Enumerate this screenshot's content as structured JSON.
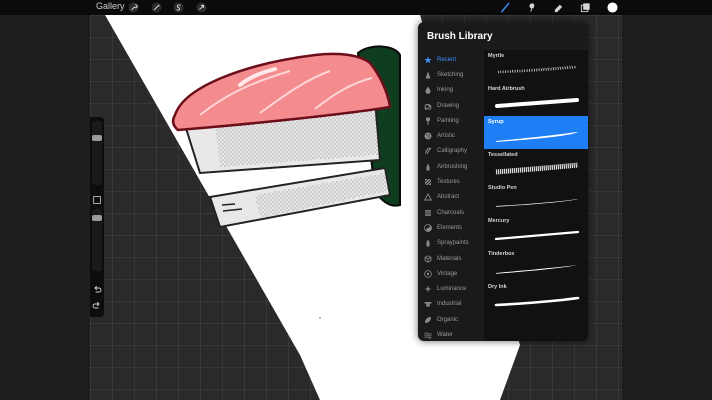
{
  "app": {
    "gallery_label": "Gallery"
  },
  "brush_library": {
    "title": "Brush Library",
    "selected_category": "Recent",
    "selected_brush": "Syrup",
    "categories": [
      {
        "label": "Recent",
        "icon": "star-icon"
      },
      {
        "label": "Sketching",
        "icon": "pencil-tip-icon"
      },
      {
        "label": "Inking",
        "icon": "ink-drop-icon"
      },
      {
        "label": "Drawing",
        "icon": "spiral-icon"
      },
      {
        "label": "Painting",
        "icon": "paint-brush-icon"
      },
      {
        "label": "Artistic",
        "icon": "palette-icon"
      },
      {
        "label": "Calligraphy",
        "icon": "calligraphy-icon"
      },
      {
        "label": "Airbrushing",
        "icon": "airbrush-icon"
      },
      {
        "label": "Textures",
        "icon": "texture-icon"
      },
      {
        "label": "Abstract",
        "icon": "triangle-icon"
      },
      {
        "label": "Charcoals",
        "icon": "charcoal-icon"
      },
      {
        "label": "Elements",
        "icon": "yin-yang-icon"
      },
      {
        "label": "Spraypaints",
        "icon": "spray-can-icon"
      },
      {
        "label": "Materials",
        "icon": "cube-icon"
      },
      {
        "label": "Vintage",
        "icon": "vintage-star-icon"
      },
      {
        "label": "Luminance",
        "icon": "sparkle-icon"
      },
      {
        "label": "Industrial",
        "icon": "anvil-icon"
      },
      {
        "label": "Organic",
        "icon": "leaf-icon"
      },
      {
        "label": "Water",
        "icon": "waves-icon"
      }
    ],
    "brushes": [
      {
        "name": "Myrtle"
      },
      {
        "name": "Hard Airbrush"
      },
      {
        "name": "Syrup"
      },
      {
        "name": "Tessellated"
      },
      {
        "name": "Studio Pen"
      },
      {
        "name": "Mercury"
      },
      {
        "name": "Tinderbox"
      },
      {
        "name": "Dry Ink"
      }
    ]
  },
  "colors": {
    "accent": "#1e7ef5",
    "current_color": "#ffffff",
    "salmon": "#f38b8f",
    "nori": "#0d3a1e"
  },
  "toolbar_icons": [
    "wrench-icon",
    "magic-wand-icon",
    "selection-icon",
    "transform-arrow-icon",
    "brush-icon",
    "smudge-icon",
    "eraser-icon",
    "layers-icon",
    "color-swatch-icon"
  ]
}
